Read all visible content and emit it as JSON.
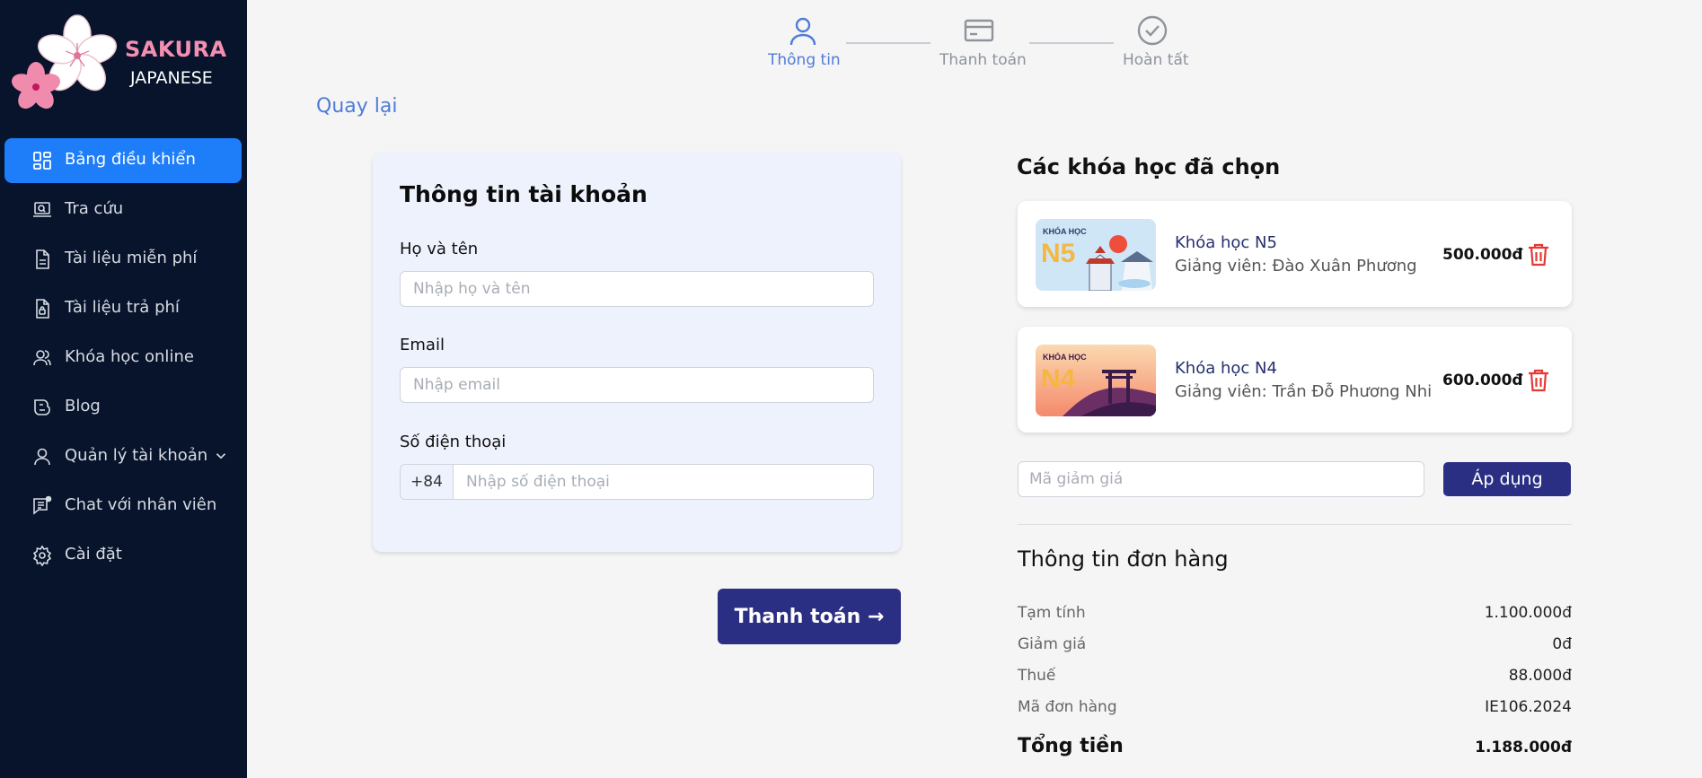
{
  "brand": {
    "name_line1": "SAKURA",
    "name_line2": "JAPANESE"
  },
  "sidebar": {
    "items": [
      {
        "label": "Bảng điều khiển",
        "icon": "dashboard-icon",
        "active": true
      },
      {
        "label": "Tra cứu",
        "icon": "laptop-search-icon"
      },
      {
        "label": "Tài liệu miễn phí",
        "icon": "document-icon"
      },
      {
        "label": "Tài liệu trả phí",
        "icon": "paid-document-icon"
      },
      {
        "label": "Khóa học online",
        "icon": "users-icon"
      },
      {
        "label": "Blog",
        "icon": "blog-icon"
      },
      {
        "label": "Quản lý tài khoản",
        "icon": "user-icon",
        "has_submenu": true
      },
      {
        "label": "Chat với nhân viên",
        "icon": "chat-icon"
      },
      {
        "label": "Cài đặt",
        "icon": "gear-icon"
      }
    ]
  },
  "stepper": {
    "steps": [
      {
        "label": "Thông tin",
        "icon": "user-icon",
        "state": "active"
      },
      {
        "label": "Thanh toán",
        "icon": "credit-card-icon",
        "state": "pending"
      },
      {
        "label": "Hoàn tất",
        "icon": "check-circle-icon",
        "state": "pending"
      }
    ]
  },
  "back": {
    "label": "Quay lại"
  },
  "account": {
    "title": "Thông tin tài khoản",
    "name_label": "Họ và tên",
    "name_placeholder": "Nhập họ và tên",
    "email_label": "Email",
    "email_placeholder": "Nhập email",
    "phone_label": "Số điện thoại",
    "phone_prefix": "+84",
    "phone_placeholder": "Nhập số điện thoại"
  },
  "pay_button": "Thanh toán →",
  "selected": {
    "title": "Các khóa học đã chọn",
    "courses": [
      {
        "thumb_text": "KHÓA HỌC",
        "level": "N5",
        "name": "Khóa học N5",
        "teacher": "Giảng viên: Đào Xuân Phương",
        "price": "500.000đ"
      },
      {
        "thumb_text": "KHÓA HỌC",
        "level": "N4",
        "name": "Khóa học N4",
        "teacher": "Giảng viên: Trần Đỗ Phương Nhi",
        "price": "600.000đ"
      }
    ]
  },
  "coupon": {
    "placeholder": "Mã giảm giá",
    "apply": "Áp dụng"
  },
  "order": {
    "title": "Thông tin đơn hàng",
    "rows": [
      {
        "label": "Tạm tính",
        "value": "1.100.000đ"
      },
      {
        "label": "Giảm giá",
        "value": "0đ"
      },
      {
        "label": "Thuế",
        "value": "88.000đ"
      },
      {
        "label": "Mã đơn hàng",
        "value": "IE106.2024"
      }
    ],
    "total_label": "Tổng tiền",
    "total_value": "1.188.000đ"
  },
  "colors": {
    "sidebar_bg": "#07142b",
    "active_nav": "#1e7df9",
    "primary_button": "#2b2f84",
    "step_active": "#4f7cd8",
    "brand_pink": "#f48fb1",
    "trash_red": "#e53935"
  }
}
